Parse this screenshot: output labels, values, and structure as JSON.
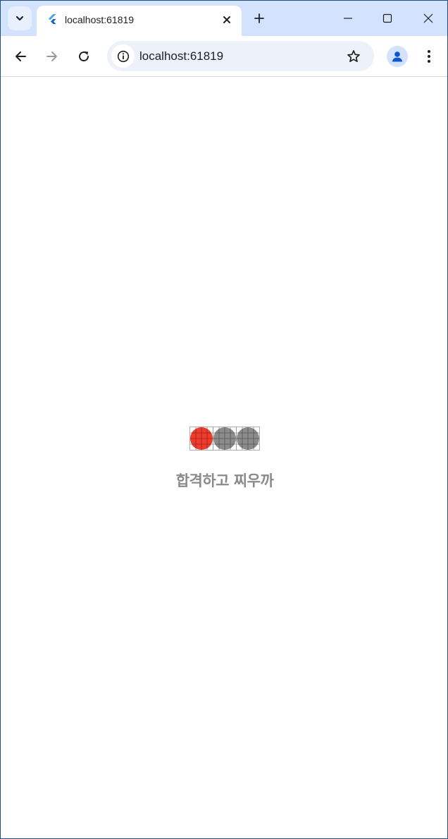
{
  "browser": {
    "tab": {
      "title": "localhost:61819",
      "favicon": "flutter-icon"
    },
    "address_bar": {
      "url": "localhost:61819"
    },
    "icons": {
      "tab_search": "chevron-down-icon",
      "tab_close": "close-icon",
      "new_tab": "plus-icon",
      "minimize": "minimize-icon",
      "maximize": "maximize-icon",
      "window_close": "close-icon",
      "back": "back-arrow-icon",
      "forward": "forward-arrow-icon",
      "reload": "reload-icon",
      "site_info": "info-icon",
      "bookmark": "star-icon",
      "profile": "profile-icon",
      "menu": "kebab-menu-icon"
    }
  },
  "page": {
    "loading_dots": [
      {
        "state": "active",
        "color": "#ee3b2c"
      },
      {
        "state": "inactive",
        "color": "#8c8c8c"
      },
      {
        "state": "inactive",
        "color": "#8c8c8c"
      }
    ],
    "title": "합격하고 찌우까"
  },
  "colors": {
    "tabstrip": "#d3e3fd",
    "omnibox": "#edf2fa",
    "active_dot": "#ee3b2c",
    "inactive_dot": "#8c8c8c",
    "title_text": "#8a8a8a"
  }
}
